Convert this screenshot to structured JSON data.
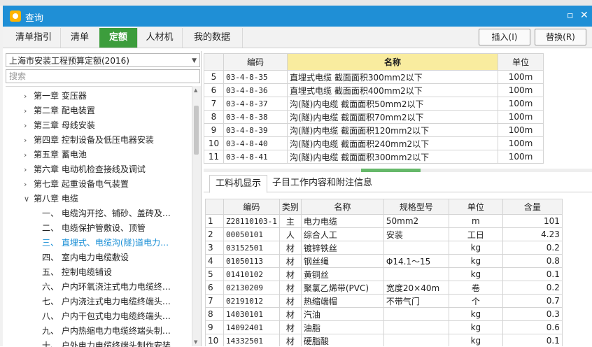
{
  "window": {
    "title": "查询"
  },
  "tabs": [
    {
      "label": "清单指引"
    },
    {
      "label": "清单"
    },
    {
      "label": "定额",
      "active": true
    },
    {
      "label": "人材机"
    },
    {
      "label": "我的数据"
    }
  ],
  "actions": {
    "insert": "插入(I)",
    "replace": "替换(R)"
  },
  "library": {
    "selected": "上海市安装工程预算定额(2016)"
  },
  "search": {
    "placeholder": "搜索"
  },
  "tree": [
    {
      "label": "第一章 变压器",
      "level": 0,
      "arrow": ">"
    },
    {
      "label": "第二章 配电装置",
      "level": 0,
      "arrow": ">"
    },
    {
      "label": "第三章 母线安装",
      "level": 0,
      "arrow": ">"
    },
    {
      "label": "第四章 控制设备及低压电器安装",
      "level": 0,
      "arrow": ">"
    },
    {
      "label": "第五章 蓄电池",
      "level": 0,
      "arrow": ">"
    },
    {
      "label": "第六章 电动机检查接线及调试",
      "level": 0,
      "arrow": ">"
    },
    {
      "label": "第七章 起重设备电气装置",
      "level": 0,
      "arrow": ">"
    },
    {
      "label": "第八章 电缆",
      "level": 0,
      "arrow": "v"
    },
    {
      "label": "一、 电缆沟开挖、铺砂、盖砖及…",
      "level": 1
    },
    {
      "label": "二、 电缆保护管敷设、顶管",
      "level": 1
    },
    {
      "label": "三、 直埋式、电缆沟(隧)道电力…",
      "level": 1,
      "selected": true
    },
    {
      "label": "四、 室内电力电缆敷设",
      "level": 1
    },
    {
      "label": "五、 控制电缆铺设",
      "level": 1
    },
    {
      "label": "六、 户内环氧浇注式电力电缆终…",
      "level": 1
    },
    {
      "label": "七、 户内浇注式电力电缆终端头…",
      "level": 1
    },
    {
      "label": "八、 户内干包式电力电缆终端头…",
      "level": 1
    },
    {
      "label": "九、 户内热缩电力电缆终端头制…",
      "level": 1
    },
    {
      "label": "十、 户外电力电缆终端头制作安装",
      "level": 1
    }
  ],
  "quota_table": {
    "headers": [
      "",
      "编码",
      "名称",
      "单位"
    ],
    "rows": [
      [
        "5",
        "03-4-8-35",
        "直埋式电缆 截面面积300mm2以下",
        "100m"
      ],
      [
        "6",
        "03-4-8-36",
        "直埋式电缆 截面面积400mm2以下",
        "100m"
      ],
      [
        "7",
        "03-4-8-37",
        "沟(隧)内电缆 截面面积50mm2以下",
        "100m"
      ],
      [
        "8",
        "03-4-8-38",
        "沟(隧)内电缆 截面面积70mm2以下",
        "100m"
      ],
      [
        "9",
        "03-4-8-39",
        "沟(隧)内电缆 截面面积120mm2以下",
        "100m"
      ],
      [
        "10",
        "03-4-8-40",
        "沟(隧)内电缆 截面面积240mm2以下",
        "100m"
      ],
      [
        "11",
        "03-4-8-41",
        "沟(隧)内电缆 截面面积300mm2以下",
        "100m"
      ]
    ]
  },
  "lower_tabs": [
    {
      "label": "工料机显示",
      "active": true
    },
    {
      "label": "子目工作内容和附注信息"
    }
  ],
  "materials": {
    "headers": [
      "",
      "编码",
      "类别",
      "名称",
      "规格型号",
      "单位",
      "含量"
    ],
    "rows": [
      [
        "1",
        "Z28110103-1",
        "主",
        "电力电缆",
        "50mm2",
        "m",
        "101"
      ],
      [
        "2",
        "00050101",
        "人",
        "综合人工",
        "安装",
        "工日",
        "4.23"
      ],
      [
        "3",
        "03152501",
        "材",
        "镀锌铁丝",
        "",
        "kg",
        "0.2"
      ],
      [
        "4",
        "01050113",
        "材",
        "钢丝绳",
        "Φ14.1～15",
        "kg",
        "0.8"
      ],
      [
        "5",
        "01410102",
        "材",
        "黄铜丝",
        "",
        "kg",
        "0.1"
      ],
      [
        "6",
        "02130209",
        "材",
        "聚氯乙烯带(PVC)",
        "宽度20×40m",
        "卷",
        "0.2"
      ],
      [
        "7",
        "02191012",
        "材",
        "热缩端帽",
        "不带气门",
        "个",
        "0.7"
      ],
      [
        "8",
        "14030101",
        "材",
        "汽油",
        "",
        "kg",
        "0.3"
      ],
      [
        "9",
        "14092401",
        "材",
        "油脂",
        "",
        "kg",
        "0.6"
      ],
      [
        "10",
        "14332501",
        "材",
        "硬脂酸",
        "",
        "kg",
        "0.1"
      ]
    ]
  },
  "colors": {
    "titlebar": "#1f8fd6",
    "active_tab": "#3c9d3c",
    "header_highlight": "#f9ec9f",
    "selected_tree": "#1a8fd6"
  }
}
